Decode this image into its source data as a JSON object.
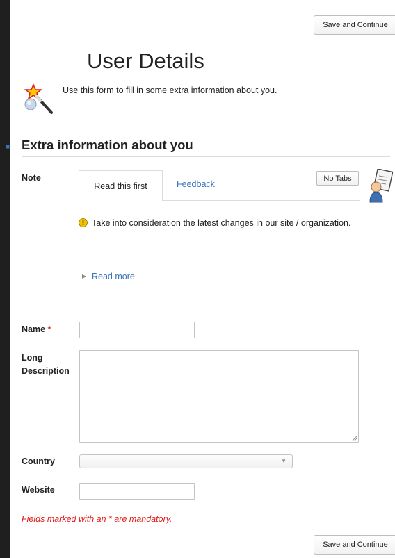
{
  "toolbar": {
    "save_label": "Save and Continue"
  },
  "page": {
    "title": "User Details",
    "intro": "Use this form to fill in some extra information about you."
  },
  "section": {
    "title": "Extra information about you"
  },
  "note": {
    "label": "Note",
    "tabs": [
      {
        "label": "Read this first",
        "active": true
      },
      {
        "label": "Feedback",
        "active": false
      }
    ],
    "no_tabs_label": "No Tabs",
    "warning": "Take into consideration the latest changes in our site / organization.",
    "read_more": "Read more"
  },
  "fields": {
    "name": {
      "label": "Name",
      "required_mark": "*",
      "value": ""
    },
    "long_description": {
      "label_line1": "Long",
      "label_line2": "Description",
      "value": ""
    },
    "country": {
      "label": "Country",
      "selected": ""
    },
    "website": {
      "label": "Website",
      "value": ""
    }
  },
  "footer": {
    "mandatory_note": "Fields marked with an * are mandatory."
  },
  "colors": {
    "link": "#3b73b9",
    "required": "#e21b1b",
    "warning": "#f2c200"
  }
}
